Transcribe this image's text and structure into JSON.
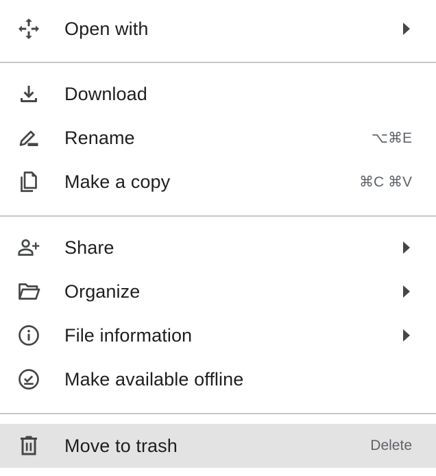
{
  "menu": {
    "groups": [
      {
        "items": [
          {
            "label": "Open with",
            "icon": "move-arrows-icon",
            "shortcut": "",
            "submenu": true
          }
        ]
      },
      {
        "items": [
          {
            "label": "Download",
            "icon": "download-icon",
            "shortcut": "",
            "submenu": false
          },
          {
            "label": "Rename",
            "icon": "rename-pencil-icon",
            "shortcut": "⌥⌘E",
            "submenu": false
          },
          {
            "label": "Make a copy",
            "icon": "copy-icon",
            "shortcut": "⌘C ⌘V",
            "submenu": false
          }
        ]
      },
      {
        "items": [
          {
            "label": "Share",
            "icon": "person-add-icon",
            "shortcut": "",
            "submenu": true
          },
          {
            "label": "Organize",
            "icon": "folder-open-icon",
            "shortcut": "",
            "submenu": true
          },
          {
            "label": "File information",
            "icon": "info-icon",
            "shortcut": "",
            "submenu": true
          },
          {
            "label": "Make available offline",
            "icon": "offline-check-icon",
            "shortcut": "",
            "submenu": false
          }
        ]
      },
      {
        "items": [
          {
            "label": "Move to trash",
            "icon": "trash-icon",
            "shortcut": "Delete",
            "submenu": false,
            "highlighted": true
          }
        ]
      }
    ]
  }
}
